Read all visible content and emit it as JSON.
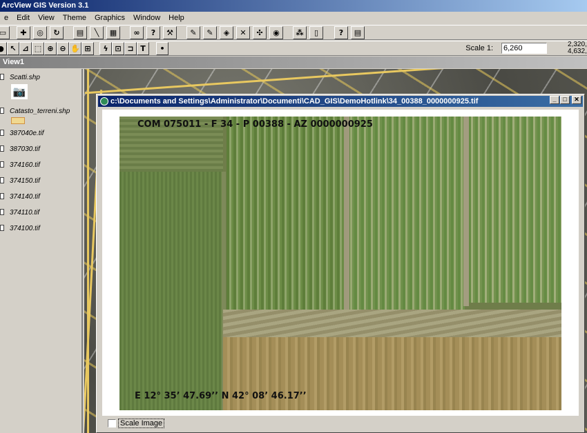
{
  "app": {
    "title": "ArcView GIS Version 3.1"
  },
  "menu": [
    {
      "label": "e",
      "id": "file"
    },
    {
      "label": "Edit",
      "id": "edit"
    },
    {
      "label": "View",
      "id": "view"
    },
    {
      "label": "Theme",
      "id": "theme"
    },
    {
      "label": "Graphics",
      "id": "graphics"
    },
    {
      "label": "Window",
      "id": "window"
    },
    {
      "label": "Help",
      "id": "help"
    }
  ],
  "toolbar": {
    "scale_label": "Scale 1:",
    "scale_value": "6,260",
    "coord_x": "2,320,",
    "coord_y": "4,632,"
  },
  "view": {
    "title": "View1"
  },
  "toc": {
    "items": [
      {
        "label": "Scatti.shp",
        "icon": "camera-icon"
      },
      {
        "label": "Catasto_terreni.shp",
        "icon": "polygon-swatch-icon"
      },
      {
        "label": "387040e.tif"
      },
      {
        "label": "387030.tif"
      },
      {
        "label": "374160.tif"
      },
      {
        "label": "374150.tif"
      },
      {
        "label": "374140.tif"
      },
      {
        "label": "374110.tif"
      },
      {
        "label": "374100.tif"
      }
    ]
  },
  "image_window": {
    "title": "c:\\Documents and Settings\\Administrator\\Documenti\\CAD_GIS\\DemoHotlink\\34_00388_0000000925.tif",
    "caption_top": "COM 075011 - F 34 - P 00388 - AZ 0000000925",
    "caption_bottom": "E 12° 35’ 47.69’’ N 42° 08’ 46.17’’",
    "scale_image_label": "Scale Image",
    "scale_image_checked": false
  },
  "colors": {
    "title_active": "#0a246a",
    "title_inactive": "#808080",
    "face": "#d4d0c8"
  }
}
